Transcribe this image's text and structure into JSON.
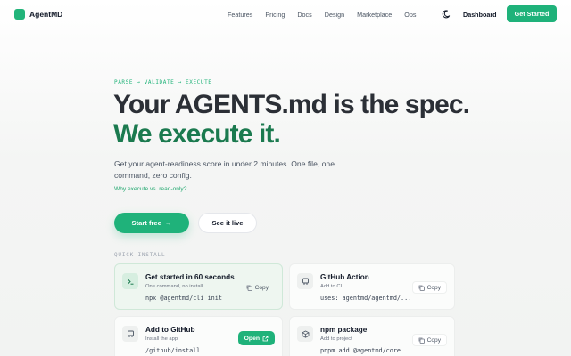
{
  "nav": {
    "brand": "AgentMD",
    "links": [
      "Features",
      "Pricing",
      "Docs",
      "Design",
      "Marketplace",
      "Ops"
    ],
    "dashboard": "Dashboard",
    "get_started": "Get Started"
  },
  "hero": {
    "eyebrow": "PARSE → VALIDATE → EXECUTE",
    "title_line1": "Your AGENTS.md is the spec.",
    "title_line2": "We execute it.",
    "subtitle": "Get your agent-readiness score in under 2 minutes. One file, one command, zero config.",
    "why_link": "Why execute vs. read-only?",
    "start_free": "Start free",
    "start_free_arrow": "→",
    "see_live": "See it live"
  },
  "quick_install": {
    "label": "QUICK INSTALL",
    "cards": [
      {
        "title": "Get started in 60 seconds",
        "desc": "One command, no install",
        "cmd": "npx @agentmd/cli init",
        "action": "Copy",
        "icon": "terminal-icon"
      },
      {
        "title": "GitHub Action",
        "desc": "Add to CI",
        "cmd": "uses: agentmd/agentmd/...",
        "action": "Copy",
        "icon": "github-icon"
      },
      {
        "title": "Add to GitHub",
        "desc": "Install the app",
        "cmd": "/github/install",
        "action": "Open",
        "icon": "github-icon"
      },
      {
        "title": "npm package",
        "desc": "Add to project",
        "cmd": "pnpm add @agentmd/core",
        "action": "Copy",
        "icon": "package-icon"
      }
    ]
  },
  "colors": {
    "accent": "#1fb27a",
    "title_green": "#1b7a4f",
    "title_dark": "#2b2f36"
  }
}
